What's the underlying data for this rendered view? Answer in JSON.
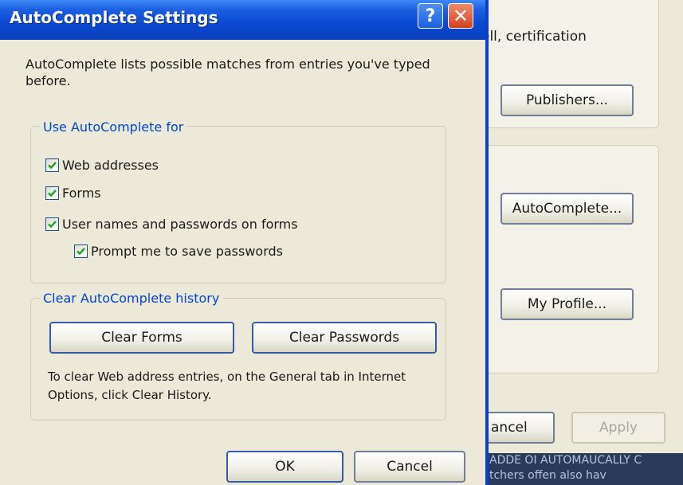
{
  "dialog": {
    "title": "AutoComplete Settings",
    "help_glyph": "?",
    "close_glyph": "✕",
    "description": "AutoComplete lists possible matches from entries you've typed before.",
    "use_group": {
      "legend": "Use AutoComplete for",
      "options": [
        {
          "label": "Web addresses",
          "checked": true
        },
        {
          "label": "Forms",
          "checked": true
        },
        {
          "label": "User names and passwords on forms",
          "checked": true
        },
        {
          "label": "Prompt me to save passwords",
          "checked": true
        }
      ]
    },
    "clear_group": {
      "legend": "Clear AutoComplete history",
      "clear_forms_label": "Clear Forms",
      "clear_passwords_label": "Clear Passwords",
      "help_text": "To clear Web address entries, on the General tab in Internet Options, click Clear History."
    },
    "ok_label": "OK",
    "cancel_label": "Cancel"
  },
  "background_window": {
    "certificate_text": "ell, certification",
    "publishers_label": "Publishers...",
    "autocomplete_label": "AutoComplete...",
    "my_profile_label": "My Profile...",
    "cancel_label": "ancel",
    "apply_label": "Apply",
    "strip_line1": "ADDE OI AUTOMAUCALLY C",
    "strip_line2": "tchers offen also hav"
  },
  "colors": {
    "titlebar_blue": "#0a49d3",
    "close_red": "#d4401e",
    "legend_blue": "#0046d5",
    "checkmark_green": "#21a121",
    "dialog_bg": "#ece9d8"
  }
}
